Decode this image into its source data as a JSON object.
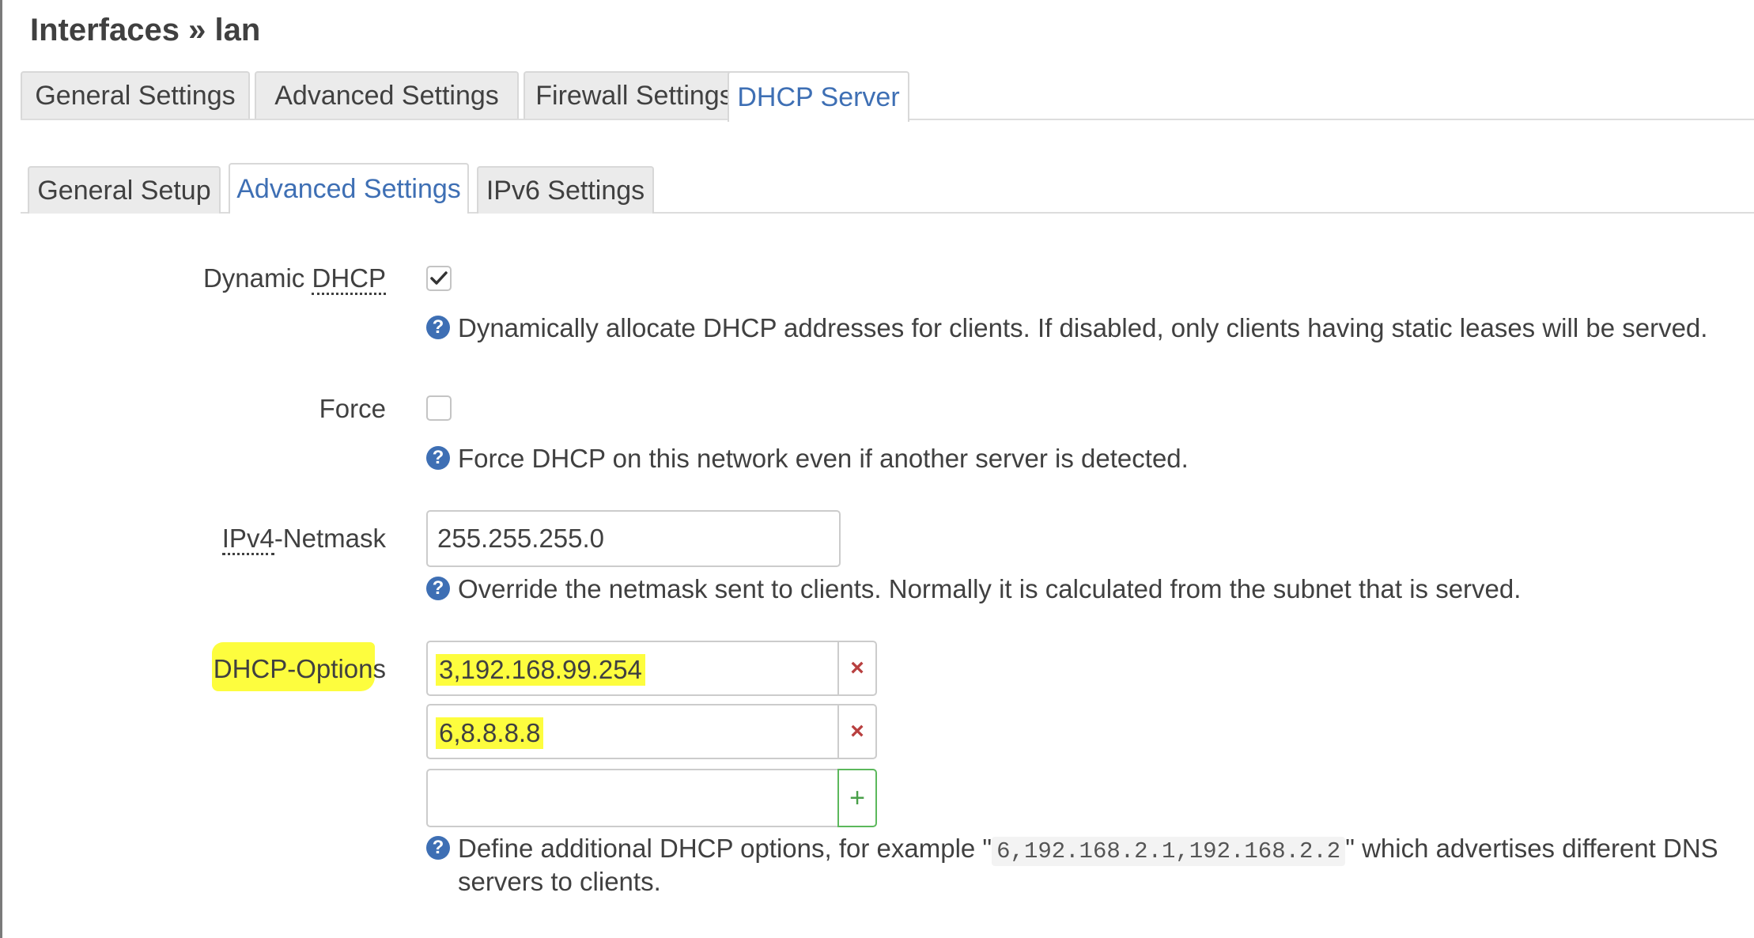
{
  "page": {
    "title": "Interfaces » lan"
  },
  "main_tabs": [
    {
      "label": "General Settings",
      "active": false
    },
    {
      "label": "Advanced Settings",
      "active": false
    },
    {
      "label": "Firewall Settings",
      "active": false
    },
    {
      "label": "DHCP Server",
      "active": true
    }
  ],
  "sub_tabs": [
    {
      "label": "General Setup",
      "active": false
    },
    {
      "label": "Advanced Settings",
      "active": true
    },
    {
      "label": "IPv6 Settings",
      "active": false
    }
  ],
  "fields": {
    "dynamic_dhcp": {
      "label_prefix": "Dynamic ",
      "label_abbr": "DHCP",
      "checked": true,
      "help": "Dynamically allocate DHCP addresses for clients. If disabled, only clients having static leases will be served."
    },
    "force": {
      "label": "Force",
      "checked": false,
      "help": "Force DHCP on this network even if another server is detected."
    },
    "netmask": {
      "label_abbr": "IPv4",
      "label_suffix": "-Netmask",
      "value": "255.255.255.0",
      "help": "Override the netmask sent to clients. Normally it is calculated from the subnet that is served."
    },
    "dhcp_options": {
      "label": "DHCP-Options",
      "values": [
        "3,192.168.99.254",
        "6,8.8.8.8"
      ],
      "new_value": "",
      "remove_symbol": "×",
      "add_symbol": "+",
      "help_prefix": "Define additional DHCP options, for example \"",
      "help_code": "6,192.168.2.1,192.168.2.2",
      "help_suffix": "\" which advertises different DNS",
      "help_line2": "servers to clients."
    }
  },
  "colors": {
    "accent": "#3e6fb4",
    "highlight": "#fdfd3e",
    "remove": "#b83f3f",
    "add": "#5cb85c"
  }
}
